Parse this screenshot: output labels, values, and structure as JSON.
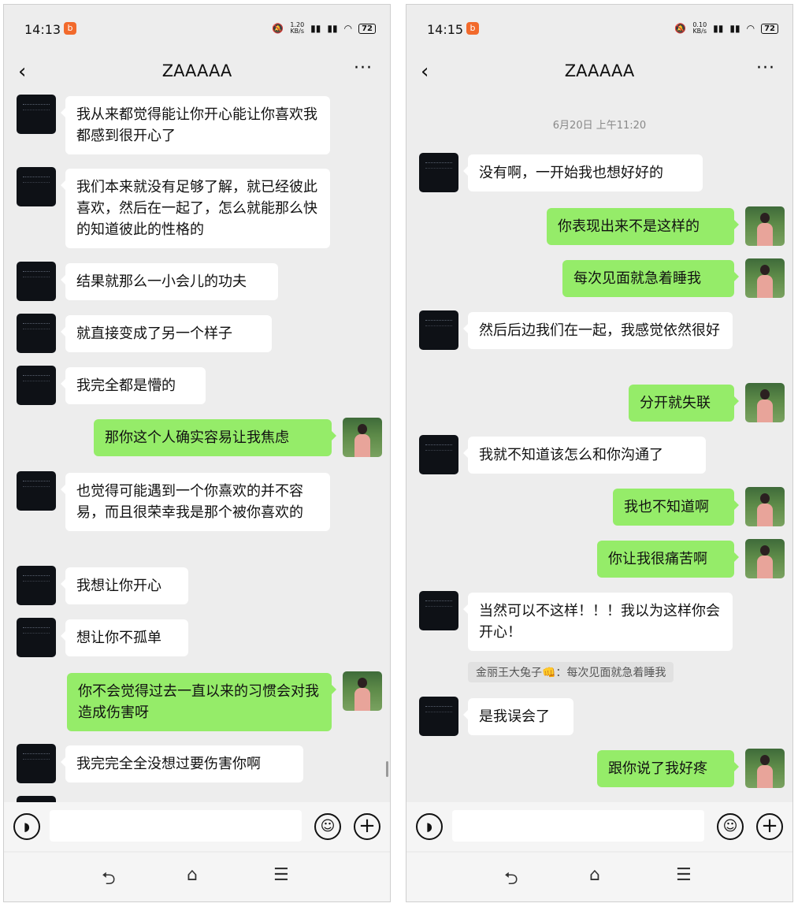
{
  "left": {
    "status_time": "14:13",
    "notification_icon": "b",
    "signal_text": "1.20\nKB/s",
    "battery": "72",
    "title": "ZAAAAA",
    "messages": [
      "我从来都觉得能让你开心能让你喜欢我都感到很开心了",
      "我们本来就没有足够了解，就已经彼此喜欢，然后在一起了，怎么就能那么快的知道彼此的性格的",
      "结果就那么一小会儿的功夫",
      "就直接变成了另一个样子",
      "我完全都是懵的",
      "那你这个人确实容易让我焦虑",
      "也觉得可能遇到一个你熹欢的并不容易，而且很荣幸我是那个被你喜欢的",
      "我想让你开心",
      "想让你不孤单",
      "你不会觉得过去一直以来的习惯会对我造成伤害呀",
      "我完完全全没想过要伤害你啊"
    ]
  },
  "right": {
    "status_time": "14:15",
    "notification_icon": "b",
    "signal_text": "0.10\nKB/s",
    "battery": "72",
    "title": "ZAAAAA",
    "timestamp": "6月20日 上午11:20",
    "messages": [
      "没有啊，一开始我也想好好的",
      "你表现出来不是这样的",
      "每次见面就急着睡我",
      "然后后边我们在一起，我感觉依然很好",
      "分开就失联",
      "我就不知道该怎么和你沟通了",
      "我也不知道啊",
      "你让我很痛苦啊",
      "当然可以不这样！！！我以为这样你会开心！",
      "是我误会了",
      "跟你说了我好疼"
    ],
    "quote": "金丽王大兔子👊：每次见面就急着睡我"
  },
  "icons": {
    "back": "‹",
    "more": "···",
    "voice": "◗",
    "emoji": "☺",
    "plus": "+",
    "nav_back": "⮌",
    "nav_home": "⌂",
    "nav_menu": "☰"
  }
}
